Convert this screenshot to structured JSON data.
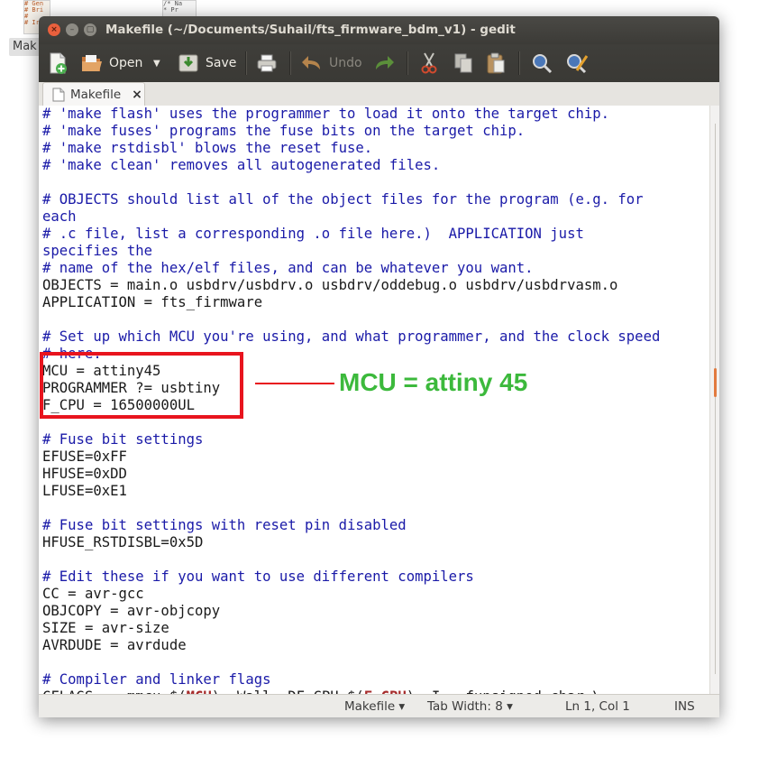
{
  "desktop": {
    "icon1_lines": [
      "# Gen",
      "# Bri",
      "#",
      "# Ird"
    ],
    "icon2_lines": [
      "/* Na",
      " * Pr"
    ],
    "label": "Mak"
  },
  "window": {
    "title": "Makefile (~/Documents/Suhail/fts_firmware_bdm_v1) - gedit",
    "close_glyph": "×",
    "min_glyph": "–",
    "max_glyph": "▢"
  },
  "toolbar": {
    "open_label": "Open",
    "save_label": "Save",
    "undo_label": "Undo"
  },
  "tabs": [
    {
      "label": "Makefile",
      "close_glyph": "×"
    }
  ],
  "editor": {
    "lines": [
      {
        "text": "# 'make flash' uses the programmer to load it onto the target chip.",
        "type": "comment"
      },
      {
        "text": "# 'make fuses' programs the fuse bits on the target chip.",
        "type": "comment"
      },
      {
        "text": "# 'make rstdisbl' blows the reset fuse.",
        "type": "comment"
      },
      {
        "text": "# 'make clean' removes all autogenerated files.",
        "type": "comment"
      },
      {
        "text": "",
        "type": "code"
      },
      {
        "text": "# OBJECTS should list all of the object files for the program (e.g. for",
        "type": "comment"
      },
      {
        "text": "each",
        "type": "comment"
      },
      {
        "text": "# .c file, list a corresponding .o file here.)  APPLICATION just",
        "type": "comment"
      },
      {
        "text": "specifies the",
        "type": "comment"
      },
      {
        "text": "# name of the hex/elf files, and can be whatever you want.",
        "type": "comment"
      },
      {
        "text": "OBJECTS = main.o usbdrv/usbdrv.o usbdrv/oddebug.o usbdrv/usbdrvasm.o",
        "type": "code"
      },
      {
        "text": "APPLICATION = fts_firmware",
        "type": "code"
      },
      {
        "text": "",
        "type": "code"
      },
      {
        "text": "# Set up which MCU you're using, and what programmer, and the clock speed",
        "type": "comment"
      },
      {
        "text": "# here.",
        "type": "comment"
      },
      {
        "text": "MCU = attiny45",
        "type": "code"
      },
      {
        "text": "PROGRAMMER ?= usbtiny",
        "type": "code"
      },
      {
        "text": "F_CPU = 16500000UL",
        "type": "code"
      },
      {
        "text": "",
        "type": "code"
      },
      {
        "text": "# Fuse bit settings",
        "type": "comment"
      },
      {
        "text": "EFUSE=0xFF",
        "type": "code"
      },
      {
        "text": "HFUSE=0xDD",
        "type": "code"
      },
      {
        "text": "LFUSE=0xE1",
        "type": "code"
      },
      {
        "text": "",
        "type": "code"
      },
      {
        "text": "# Fuse bit settings with reset pin disabled",
        "type": "comment"
      },
      {
        "text": "HFUSE_RSTDISBL=0x5D",
        "type": "code"
      },
      {
        "text": "",
        "type": "code"
      },
      {
        "text": "# Edit these if you want to use different compilers",
        "type": "comment"
      },
      {
        "text": "CC = avr-gcc",
        "type": "code"
      },
      {
        "text": "OBJCOPY = avr-objcopy",
        "type": "code"
      },
      {
        "text": "SIZE = avr-size",
        "type": "code"
      },
      {
        "text": "AVRDUDE = avrdude",
        "type": "code"
      },
      {
        "text": "",
        "type": "code"
      },
      {
        "text": "# Compiler and linker flags",
        "type": "comment"
      },
      {
        "text": "CFLAGS = -mmcu=$(",
        "type": "code",
        "rest": [
          {
            "t": "MCU",
            "c": "var"
          },
          {
            "t": ") -Wall -DF_CPU=$(",
            "c": ""
          },
          {
            "t": "F_CPU",
            "c": "var"
          },
          {
            "t": ") -I. -funsigned-char \\",
            "c": ""
          }
        ]
      }
    ]
  },
  "statusbar": {
    "language": "Makefile ▾",
    "tab_width": "Tab Width: 8 ▾",
    "position": "Ln 1, Col 1",
    "mode": "INS"
  },
  "annotation": {
    "label": "MCU = attiny 45",
    "color": "#3cb93c",
    "box_color": "#e8141e"
  },
  "colors": {
    "comment": "#1a1aa8",
    "variable": "#a52a2a",
    "titlebar": "#3c3b37",
    "close_button": "#e9603d",
    "scroll_thumb": "#e27a3f"
  }
}
